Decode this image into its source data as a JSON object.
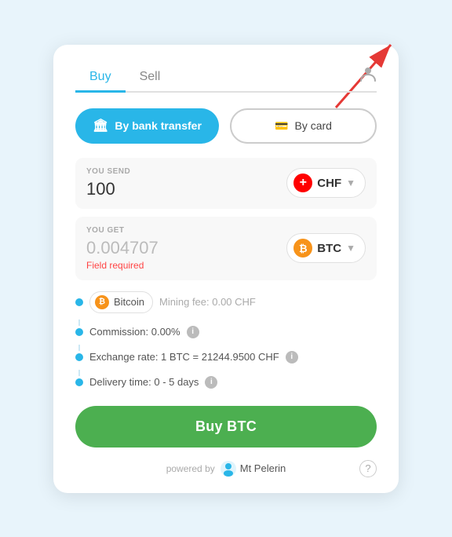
{
  "tabs": {
    "buy": "Buy",
    "sell": "Sell",
    "active": "buy"
  },
  "payment": {
    "bank_label": "By bank transfer",
    "card_label": "By card"
  },
  "send": {
    "label": "YOU SEND",
    "value": "100",
    "currency_code": "CHF"
  },
  "get": {
    "label": "YOU GET",
    "value": "0.004707",
    "field_required": "Field required",
    "currency_code": "BTC"
  },
  "bitcoin_row": {
    "label": "Bitcoin",
    "mining_fee": "Mining fee: 0.00 CHF"
  },
  "details": {
    "commission": "Commission: 0.00%",
    "exchange_rate": "Exchange rate: 1 BTC = 21244.9500 CHF",
    "delivery_time": "Delivery time: 0 - 5 days"
  },
  "buy_button": "Buy BTC",
  "footer": {
    "powered_by": "powered by",
    "brand": "Mt\nPelerin"
  },
  "icons": {
    "user": "👤",
    "bank": "🏛",
    "card": "💳",
    "info": "i",
    "help": "?",
    "btc": "₿"
  }
}
